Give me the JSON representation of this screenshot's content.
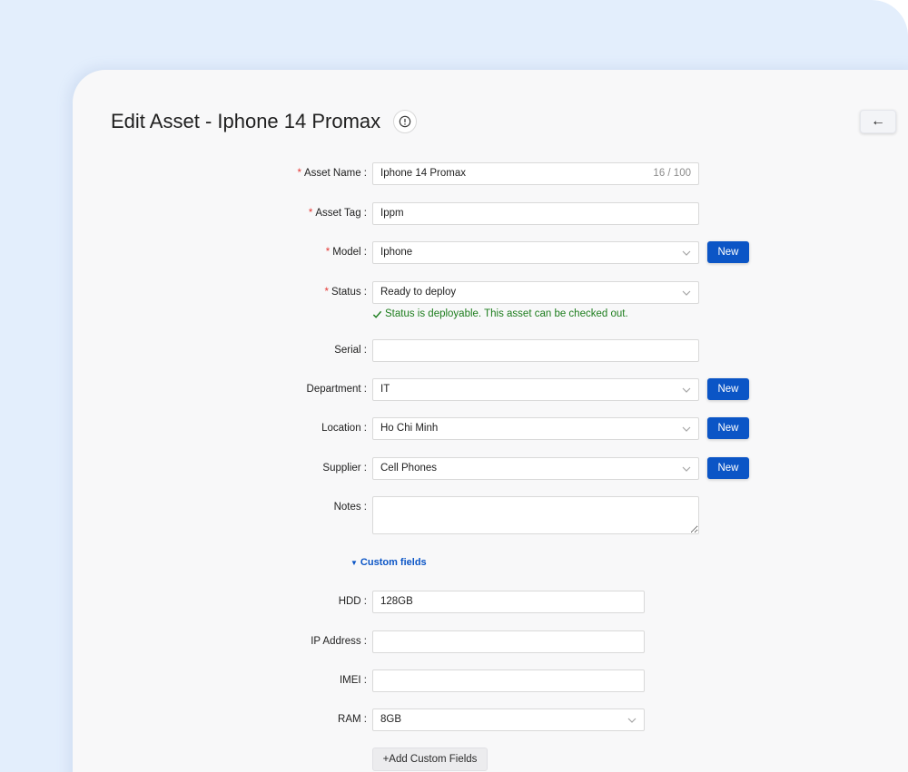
{
  "header": {
    "title": "Edit Asset - Iphone 14 Promax",
    "info_icon": "info-icon",
    "back_icon": "arrow-left-icon",
    "back_glyph": "←"
  },
  "form": {
    "required_mark": "*",
    "asset_name": {
      "label": "Asset Name",
      "value": "Iphone 14 Promax",
      "count": "16 / 100"
    },
    "asset_tag": {
      "label": "Asset Tag",
      "value": "Ippm"
    },
    "model": {
      "label": "Model",
      "value": "Iphone",
      "new_label": "New"
    },
    "status": {
      "label": "Status",
      "value": "Ready to deploy",
      "help": "Status is deployable. This asset can be checked out."
    },
    "serial": {
      "label": "Serial",
      "value": ""
    },
    "department": {
      "label": "Department",
      "value": "IT",
      "new_label": "New"
    },
    "location": {
      "label": "Location",
      "value": "Ho Chi Minh",
      "new_label": "New"
    },
    "supplier": {
      "label": "Supplier",
      "value": "Cell Phones",
      "new_label": "New"
    },
    "notes": {
      "label": "Notes",
      "value": ""
    }
  },
  "custom_fields": {
    "toggle_label": "Custom fields",
    "hdd": {
      "label": "HDD",
      "value": "128GB"
    },
    "ip_address": {
      "label": "IP Address",
      "value": ""
    },
    "imei": {
      "label": "IMEI",
      "value": ""
    },
    "ram": {
      "label": "RAM",
      "value": "8GB"
    },
    "add_label": "+Add Custom Fields"
  },
  "colors": {
    "primary": "#0b55c6",
    "success": "#1d7d1d",
    "required": "#e53935"
  }
}
